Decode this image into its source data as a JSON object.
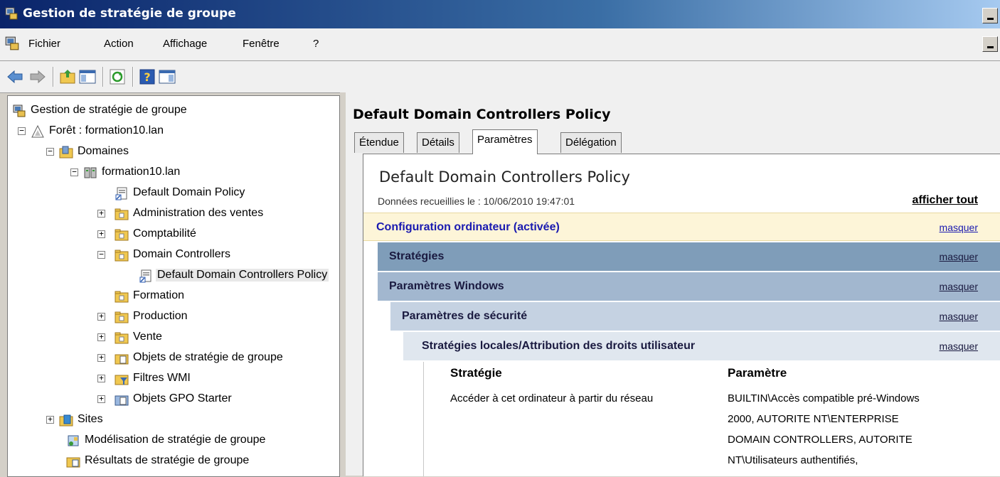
{
  "window": {
    "title": "Gestion de stratégie de groupe"
  },
  "menu": {
    "items": [
      "Fichier",
      "Action",
      "Affichage",
      "Fenêtre",
      "?"
    ]
  },
  "tree": {
    "items": [
      {
        "label": "Gestion de stratégie de groupe"
      },
      {
        "label": "Forêt : formation10.lan"
      },
      {
        "label": "Domaines"
      },
      {
        "label": "formation10.lan"
      },
      {
        "label": "Default Domain Policy"
      },
      {
        "label": "Administration des ventes"
      },
      {
        "label": "Comptabilité"
      },
      {
        "label": "Domain Controllers"
      },
      {
        "label": "Default Domain Controllers Policy"
      },
      {
        "label": "Formation"
      },
      {
        "label": "Production"
      },
      {
        "label": "Vente"
      },
      {
        "label": "Objets de stratégie de groupe"
      },
      {
        "label": "Filtres WMI"
      },
      {
        "label": "Objets GPO Starter"
      },
      {
        "label": "Sites"
      },
      {
        "label": "Modélisation de stratégie de groupe"
      },
      {
        "label": "Résultats de stratégie de groupe"
      }
    ]
  },
  "right": {
    "title": "Default Domain Controllers Policy",
    "tabs": [
      "Étendue",
      "Détails",
      "Paramètres",
      "Délégation"
    ],
    "active_tab": "Paramètres"
  },
  "report": {
    "title": "Default Domain Controllers Policy",
    "date_line": "Données recueillies le : 10/06/2010 19:47:01",
    "show_all": "afficher tout",
    "sections": [
      {
        "label": "Configuration ordinateur (activée)",
        "action": "masquer",
        "color": "#fdf5d8"
      },
      {
        "label": "Stratégies",
        "action": "masquer",
        "color": "#7f9db9"
      },
      {
        "label": "Paramètres Windows",
        "action": "masquer",
        "color": "#a2b7cf"
      },
      {
        "label": "Paramètres de sécurité",
        "action": "masquer",
        "color": "#c5d2e2"
      },
      {
        "label": "Stratégies locales/Attribution des droits utilisateur",
        "action": "masquer",
        "color": "#e0e7ef"
      }
    ],
    "table": {
      "headers": [
        "Stratégie",
        "Paramètre"
      ],
      "rows": [
        {
          "policy": "Accéder à cet ordinateur à partir du réseau",
          "setting_lines": [
            "BUILTIN\\Accès compatible pré-Windows",
            "2000, AUTORITE NT\\ENTERPRISE",
            "DOMAIN CONTROLLERS, AUTORITE",
            "NT\\Utilisateurs authentifiés,"
          ]
        }
      ]
    }
  }
}
